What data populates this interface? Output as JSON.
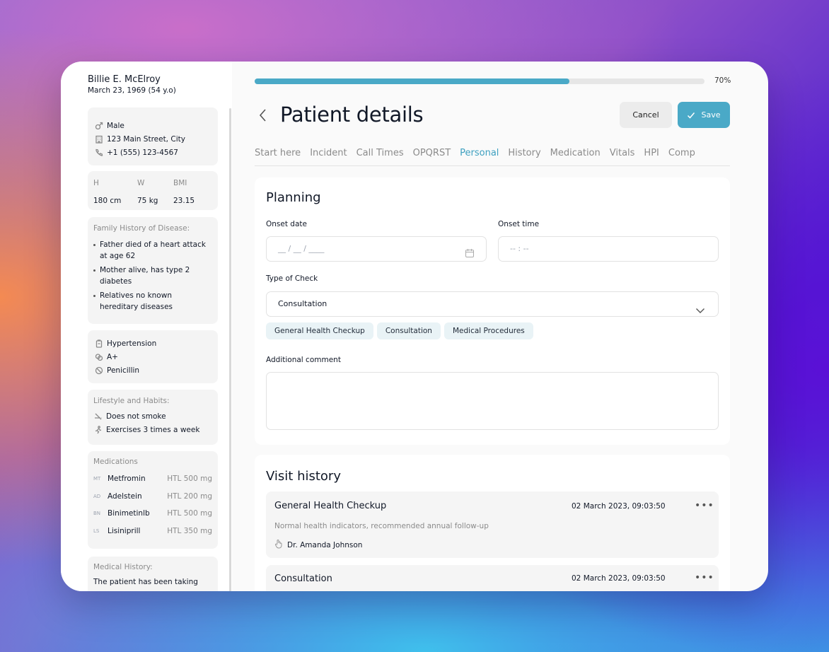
{
  "patient": {
    "name": "Billie E. McElroy",
    "dob": "March 23, 1969 (54 y.o)"
  },
  "contact": {
    "sex": "Male",
    "address": "123 Main Street, City",
    "phone": "+1 (555) 123-4567"
  },
  "metrics": {
    "h_label": "H",
    "w_label": "W",
    "bmi_label": "BMI",
    "h": "180 cm",
    "w": "75 kg",
    "bmi": "23.15"
  },
  "family_history": {
    "label": "Family History of Disease:",
    "items": [
      "Father died of a heart attack at age 62",
      "Mother alive, has type 2 diabetes",
      "Relatives no known hereditary diseases"
    ]
  },
  "conditions": {
    "condition": "Hypertension",
    "blood_type": "A+",
    "allergy": "Penicillin"
  },
  "lifestyle": {
    "label": "Lifestyle and Habits:",
    "smoke": "Does not smoke",
    "exercise": "Exercises 3 times a week"
  },
  "medications": {
    "label": "Medications",
    "items": [
      {
        "abbr": "MT",
        "name": "Metfromin",
        "dose": "HTL 500 mg"
      },
      {
        "abbr": "AD",
        "name": "Adelstein",
        "dose": "HTL 200 mg"
      },
      {
        "abbr": "BN",
        "name": "Binimetinlb",
        "dose": "HTL 500 mg"
      },
      {
        "abbr": "LS",
        "name": "Lisiniprill",
        "dose": "HTL 350 mg"
      }
    ]
  },
  "medical_history": {
    "label": "Medical History:",
    "text": "The patient has been taking"
  },
  "progress": {
    "value": 0.7,
    "label": "70%"
  },
  "header": {
    "title": "Patient details",
    "cancel": "Cancel",
    "save": "Save"
  },
  "tabs": [
    "Start here",
    "Incident",
    "Call Times",
    "OPQRST",
    "Personal",
    "History",
    "Medication",
    "Vitals",
    "HPI",
    "Comp"
  ],
  "active_tab": "Personal",
  "planning": {
    "title": "Planning",
    "onset_date_label": "Onset date",
    "onset_date_placeholder": "__ / __ / ____",
    "onset_time_label": "Onset time",
    "onset_time_placeholder": "-- : --",
    "check_label": "Type of Check",
    "check_value": "Consultation",
    "chips": [
      "General Health Checkup",
      "Consultation",
      "Medical Procedures"
    ],
    "comment_label": "Additional comment"
  },
  "visit_history": {
    "title": "Visit history",
    "items": [
      {
        "title": "General Health Checkup",
        "date": "02 March 2023, 09:03:50",
        "note": "Normal health indicators, recommended annual follow-up",
        "doctor": "Dr. Amanda Johnson"
      },
      {
        "title": "Consultation",
        "date": "02 March 2023, 09:03:50"
      }
    ]
  },
  "colors": {
    "accent": "#4aa9c7",
    "card_bg": "#f4f4f4",
    "chip_bg": "#e9f3f6"
  }
}
